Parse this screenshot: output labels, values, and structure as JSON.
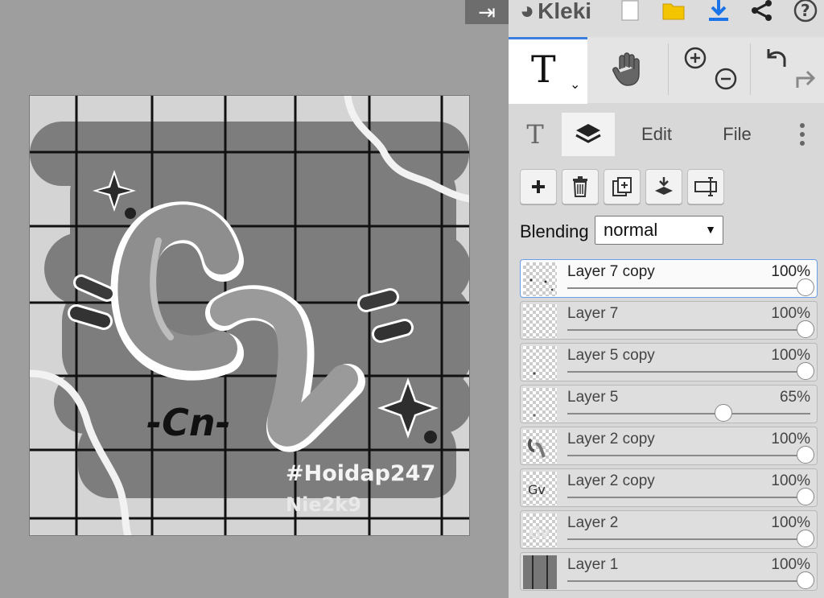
{
  "app": {
    "name": "Kleki"
  },
  "topbar": {
    "icons": [
      "kleki-logo-icon",
      "new-file-icon",
      "open-folder-icon",
      "download-icon",
      "share-icon",
      "help-icon"
    ],
    "collapse_glyph": "⇥"
  },
  "tools": {
    "active_tool": "text",
    "active_glyph": "T",
    "items": [
      "hand-icon",
      "zoom-in-icon",
      "zoom-out-icon",
      "undo-icon",
      "redo-icon"
    ]
  },
  "tabs": {
    "items": [
      {
        "id": "tool-settings",
        "label": "T"
      },
      {
        "id": "layers",
        "label": ""
      },
      {
        "id": "edit",
        "label": "Edit"
      },
      {
        "id": "file",
        "label": "File"
      }
    ],
    "active": "layers"
  },
  "layer_actions": [
    "add-layer",
    "delete-layer",
    "duplicate-layer",
    "merge-down-layer",
    "rename-layer"
  ],
  "blending": {
    "label": "Blending",
    "value": "normal"
  },
  "layers": [
    {
      "name": "Layer 7 copy",
      "opacity_label": "100%",
      "opacity": 1.0,
      "selected": true
    },
    {
      "name": "Layer 7",
      "opacity_label": "100%",
      "opacity": 1.0,
      "selected": false
    },
    {
      "name": "Layer 5 copy",
      "opacity_label": "100%",
      "opacity": 1.0,
      "selected": false
    },
    {
      "name": "Layer 5",
      "opacity_label": "65%",
      "opacity": 0.65,
      "selected": false
    },
    {
      "name": "Layer 2 copy",
      "opacity_label": "100%",
      "opacity": 1.0,
      "selected": false
    },
    {
      "name": "Layer 2 copy",
      "opacity_label": "100%",
      "opacity": 1.0,
      "selected": false
    },
    {
      "name": "Layer 2",
      "opacity_label": "100%",
      "opacity": 1.0,
      "selected": false
    },
    {
      "name": "Layer 1",
      "opacity_label": "100%",
      "opacity": 1.0,
      "selected": false
    }
  ],
  "canvas": {
    "tag_text": "#Hoidap247",
    "author_text": "Nie2k9",
    "signature_text": "-Cn-",
    "colors": {
      "bg": "#d4d4d4",
      "blob": "#7a7a7a",
      "grid": "#111111"
    }
  }
}
